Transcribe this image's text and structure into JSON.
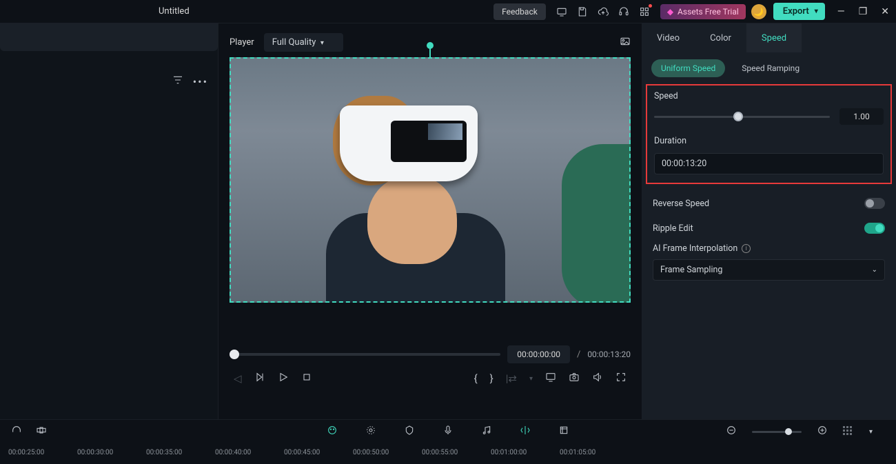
{
  "titlebar": {
    "project_title": "Untitled",
    "feedback": "Feedback",
    "assets_trial": "Assets Free Trial",
    "export": "Export"
  },
  "player": {
    "label": "Player",
    "quality": "Full Quality",
    "current_time": "00:00:00:00",
    "total_time": "00:00:13:20"
  },
  "inspector": {
    "tabs": {
      "video": "Video",
      "color": "Color",
      "speed": "Speed"
    },
    "subtabs": {
      "uniform": "Uniform Speed",
      "ramping": "Speed Ramping"
    },
    "speed_label": "Speed",
    "speed_value": "1.00",
    "duration_label": "Duration",
    "duration_value": "00:00:13:20",
    "reverse_label": "Reverse Speed",
    "ripple_label": "Ripple Edit",
    "interp_label": "AI Frame Interpolation",
    "interp_value": "Frame Sampling"
  },
  "ruler": {
    "ticks": [
      "00:00:25:00",
      "00:00:30:00",
      "00:00:35:00",
      "00:00:40:00",
      "00:00:45:00",
      "00:00:50:00",
      "00:00:55:00",
      "00:01:00:00",
      "00:01:05:00"
    ]
  }
}
